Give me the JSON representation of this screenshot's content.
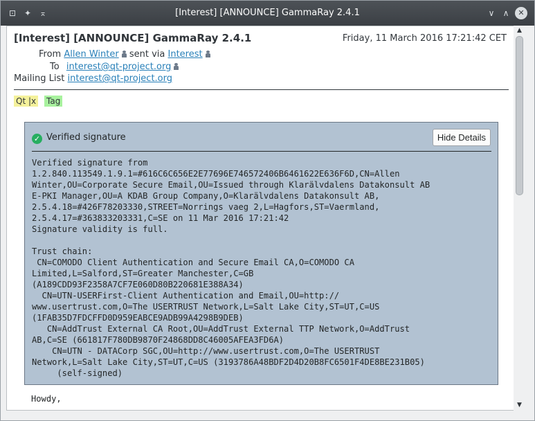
{
  "window": {
    "title": "[Interest] [ANNOUNCE] GammaRay 2.4.1"
  },
  "message": {
    "subject": "[Interest] [ANNOUNCE] GammaRay 2.4.1",
    "date": "Friday, 11 March 2016 17:21:42 CET",
    "from_label": "From",
    "from_name": "Allen Winter",
    "sent_via_label": "sent via",
    "via_name": "Interest",
    "to_label": "To",
    "to_address": "interest@qt-project.org",
    "mailing_list_label": "Mailing List",
    "mailing_list_address": "interest@qt-project.org",
    "tags": [
      "Qt |x",
      "Tag"
    ],
    "body_first_line": "Howdy,"
  },
  "signature": {
    "status": "Verified signature",
    "hide_button": "Hide Details",
    "details": "Verified signature from\n1.2.840.113549.1.9.1=#616C6C656E2E77696E746572406B6461622E636F6D,CN=Allen\nWinter,OU=Corporate Secure Email,OU=Issued through Klarälvdalens Datakonsult AB\nE-PKI Manager,OU=A KDAB Group Company,O=Klarälvdalens Datakonsult AB,\n2.5.4.18=#426F78203330,STREET=Norrings vaeg 2,L=Hagfors,ST=Vaermland,\n2.5.4.17=#363833203331,C=SE on 11 Mar 2016 17:21:42\nSignature validity is full.\n\nTrust chain:\n CN=COMODO Client Authentication and Secure Email CA,O=COMODO CA\nLimited,L=Salford,ST=Greater Manchester,C=GB\n(A189CDD93F2358A7CF7E060D80B220681E388A34)\n  CN=UTN-USERFirst-Client Authentication and Email,OU=http://\nwww.usertrust.com,O=The USERTRUST Network,L=Salt Lake City,ST=UT,C=US\n(1FAB35D7FDCFFD0D959EABCE9ADB99A4298B9DEB)\n   CN=AddTrust External CA Root,OU=AddTrust External TTP Network,O=AddTrust\nAB,C=SE (661817F780DB9870F24868DD8C46005AFEA3FD6A)\n    CN=UTN - DATACorp SGC,OU=http://www.usertrust.com,O=The USERTRUST\nNetwork,L=Salt Lake City,ST=UT,C=US (3193786A48BDF2D4D20B8FC6501F4DE8BE231B05)\n     (self-signed)"
  },
  "titlebar_icons": [
    "menu-icon",
    "pin-icon",
    "keep-above-icon",
    "minimize-icon",
    "maximize-icon",
    "close-icon"
  ]
}
